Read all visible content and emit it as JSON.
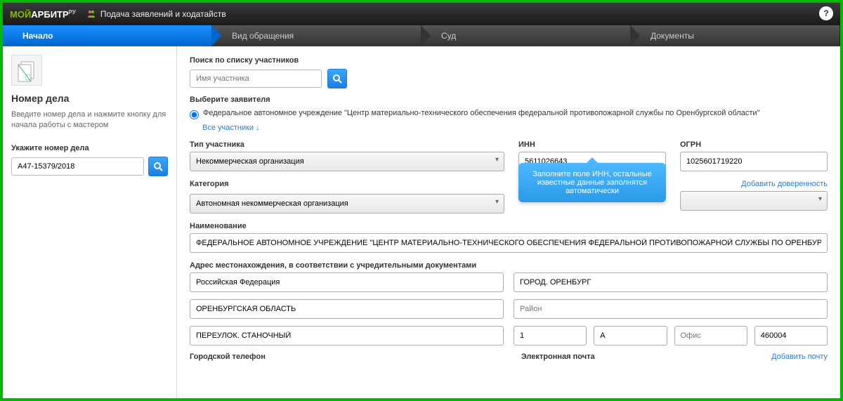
{
  "header": {
    "logo_prefix": "МОЙ",
    "logo_main": "АРБИТР",
    "logo_suffix": "РУ",
    "title": "Подача заявлений и ходатайств"
  },
  "steps": {
    "start": "Начало",
    "type": "Вид обращения",
    "court": "Суд",
    "documents": "Документы"
  },
  "sidebar": {
    "title": "Номер дела",
    "description": "Введите номер дела и нажмите кнопку для начала работы с мастером",
    "input_label": "Укажите номер дела",
    "case_number": "А47-15379/2018"
  },
  "search": {
    "label": "Поиск по списку участников",
    "placeholder": "Имя участника"
  },
  "applicant": {
    "label": "Выберите заявителя",
    "option": "Федеральное автономное учреждение \"Центр материально-технического обеспечения федеральной противопожарной службы по Оренбургской области\"",
    "all_link": "Все участники ↓"
  },
  "form": {
    "type_label": "Тип участника",
    "type_value": "Некоммерческая организация",
    "inn_label": "ИНН",
    "inn_value": "5611026643",
    "ogrn_label": "ОГРН",
    "ogrn_value": "1025601719220",
    "category_label": "Категория",
    "category_value": "Автономная некоммерческая организация",
    "add_attorney_link": "Добавить доверенность",
    "tooltip": "Заполните поле ИНН, остальные известные данные заполнятся автоматически",
    "name_label": "Наименование",
    "name_value": "ФЕДЕРАЛЬНОЕ АВТОНОМНОЕ УЧРЕЖДЕНИЕ \"ЦЕНТР МАТЕРИАЛЬНО-ТЕХНИЧЕСКОГО ОБЕСПЕЧЕНИЯ ФЕДЕРАЛЬНОЙ ПРОТИВОПОЖАРНОЙ СЛУЖБЫ ПО ОРЕНБУРГСКОЙ ОБЛАСТИ\"",
    "address_label": "Адрес местонахождения, в соответствии с учредительными документами",
    "country": "Российская Федерация",
    "region": "ОРЕНБУРГСКАЯ ОБЛАСТЬ",
    "street": "ПЕРЕУЛОК. СТАНОЧНЫЙ",
    "city": "ГОРОД. ОРЕНБУРГ",
    "district_placeholder": "Район",
    "house": "1",
    "building": "А",
    "office_placeholder": "Офис",
    "postcode": "460004",
    "phone_label": "Городской телефон",
    "email_label": "Электронная почта",
    "add_email_link": "Добавить почту"
  }
}
